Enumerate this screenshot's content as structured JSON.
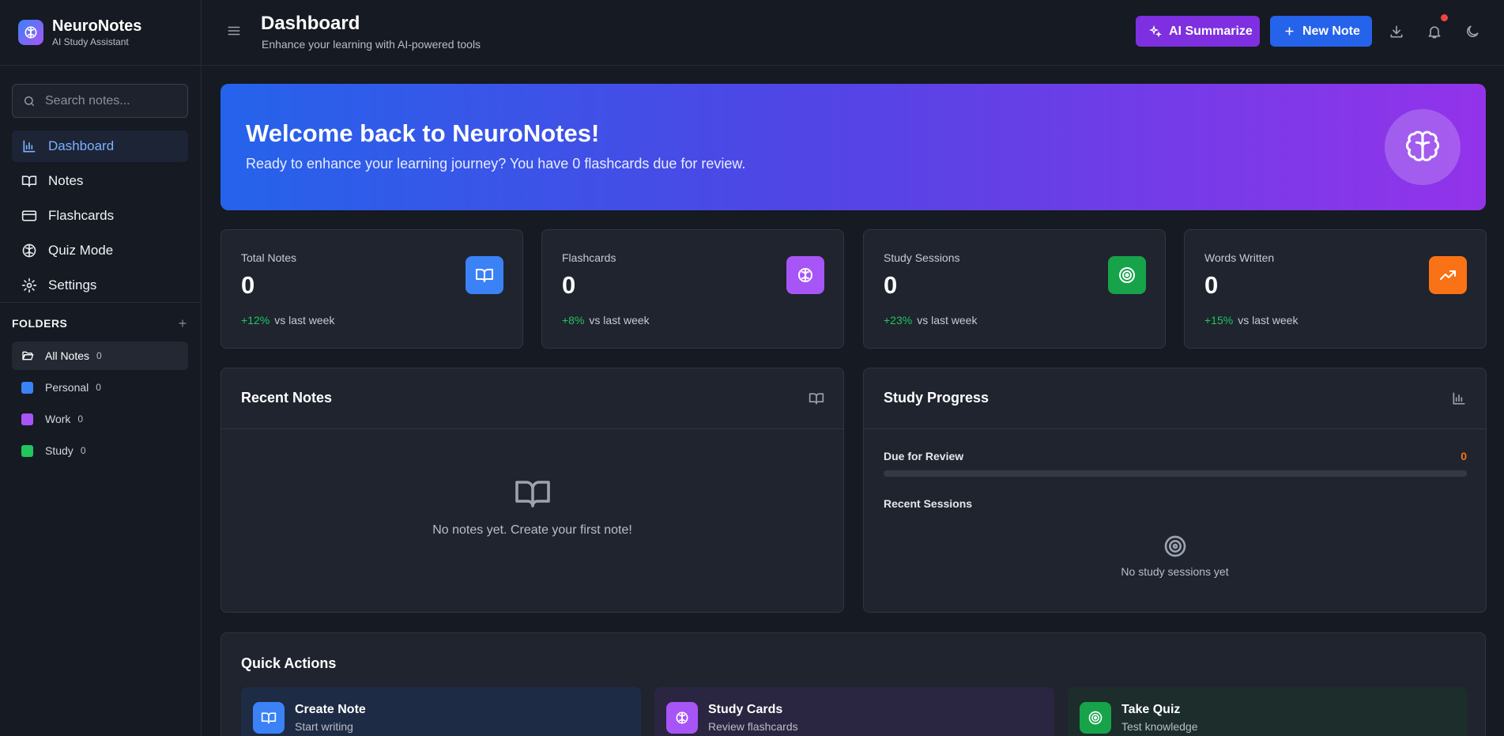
{
  "brand": {
    "title": "NeuroNotes",
    "subtitle": "AI Study Assistant"
  },
  "search": {
    "placeholder": "Search notes..."
  },
  "nav": {
    "items": [
      {
        "label": "Dashboard",
        "icon": "chart-bar-icon",
        "active": true
      },
      {
        "label": "Notes",
        "icon": "book-open-icon"
      },
      {
        "label": "Flashcards",
        "icon": "credit-card-icon"
      },
      {
        "label": "Quiz Mode",
        "icon": "brain-icon"
      },
      {
        "label": "Settings",
        "icon": "gear-icon"
      }
    ]
  },
  "folders": {
    "title": "FOLDERS",
    "items": [
      {
        "label": "All Notes",
        "count": "0",
        "icon": "folder-open-icon"
      },
      {
        "label": "Personal",
        "count": "0",
        "color": "#3b82f6"
      },
      {
        "label": "Work",
        "count": "0",
        "color": "#a855f7"
      },
      {
        "label": "Study",
        "count": "0",
        "color": "#22c55e"
      }
    ]
  },
  "header": {
    "title": "Dashboard",
    "subtitle": "Enhance your learning with AI-powered tools",
    "ai_button": "AI Summarize",
    "new_button": "New Note"
  },
  "hero": {
    "title": "Welcome back to NeuroNotes!",
    "subtitle": "Ready to enhance your learning journey? You have 0 flashcards due for review."
  },
  "stats": [
    {
      "label": "Total Notes",
      "value": "0",
      "trend": "+12%",
      "suffix": "vs last week",
      "color": "#3b82f6",
      "icon": "book-open-icon"
    },
    {
      "label": "Flashcards",
      "value": "0",
      "trend": "+8%",
      "suffix": "vs last week",
      "color": "#a855f7",
      "icon": "brain-icon"
    },
    {
      "label": "Study Sessions",
      "value": "0",
      "trend": "+23%",
      "suffix": "vs last week",
      "color": "#16a34a",
      "icon": "target-icon"
    },
    {
      "label": "Words Written",
      "value": "0",
      "trend": "+15%",
      "suffix": "vs last week",
      "color": "#f97316",
      "icon": "trending-up-icon"
    }
  ],
  "recent_notes": {
    "title": "Recent Notes",
    "empty": "No notes yet. Create your first note!"
  },
  "study_progress": {
    "title": "Study Progress",
    "due_label": "Due for Review",
    "due_value": "0",
    "due_progress": 0,
    "sessions_label": "Recent Sessions",
    "empty": "No study sessions yet"
  },
  "quick_actions": {
    "title": "Quick Actions",
    "items": [
      {
        "name": "Create Note",
        "desc": "Start writing",
        "color": "#3b82f6"
      },
      {
        "name": "Study Cards",
        "desc": "Review flashcards",
        "color": "#a855f7"
      },
      {
        "name": "Take Quiz",
        "desc": "Test knowledge",
        "color": "#16a34a"
      }
    ]
  }
}
